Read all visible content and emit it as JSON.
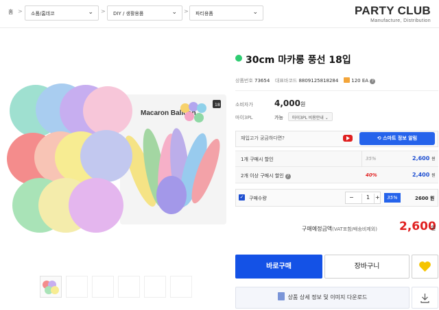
{
  "breadcrumb": {
    "home": "홈",
    "sep": ">",
    "cat1": "소품/홈데코",
    "cat2": "DIY / 생활용품",
    "cat3": "파티용품"
  },
  "logo": {
    "main": "PARTY CLUB",
    "sub": "Manufacture, Distribution"
  },
  "product": {
    "title": "30cm 마카롱 풍선 18입",
    "package_text": "Macaron Balloon",
    "package_count": "18",
    "status_color": "#2ecc71"
  },
  "meta": {
    "code_label": "상품번호",
    "code": "73654",
    "barcode_label": "대표바코드",
    "barcode": "8809125818284",
    "unit": "120 EA"
  },
  "pricing": {
    "consumer_label": "소비자가",
    "consumer_price": "4,000",
    "won": "원",
    "seller_label": "마이3PL",
    "seller_value": "가능",
    "seller_badge": "마이3PL 비용안내 ⌄"
  },
  "question": {
    "text": "재입고가 궁금하다면?",
    "smart_btn": "스마트 정보 알림"
  },
  "discounts": [
    {
      "label": "1개 구매시 할인",
      "pct": "35%",
      "price": "2,600",
      "won": "원"
    },
    {
      "label": "2개 이상 구매시 할인",
      "pct": "40%",
      "price": "2,400",
      "won": "원"
    }
  ],
  "quantity": {
    "label": "구매수량",
    "value": "1",
    "minus": "−",
    "plus": "+",
    "pct": "35%",
    "price": "2600 원"
  },
  "total": {
    "label": "구매예정금액",
    "note": "(VAT포함/배송비제외)",
    "value": "2,600",
    "won": "원"
  },
  "actions": {
    "buy": "바로구매",
    "cart": "장바구니",
    "download": "상품 상세 정보 및 이미지 다운로드"
  },
  "colors": {
    "accent": "#1452e6",
    "sale": "#e02020",
    "wish": "#f5c400"
  }
}
